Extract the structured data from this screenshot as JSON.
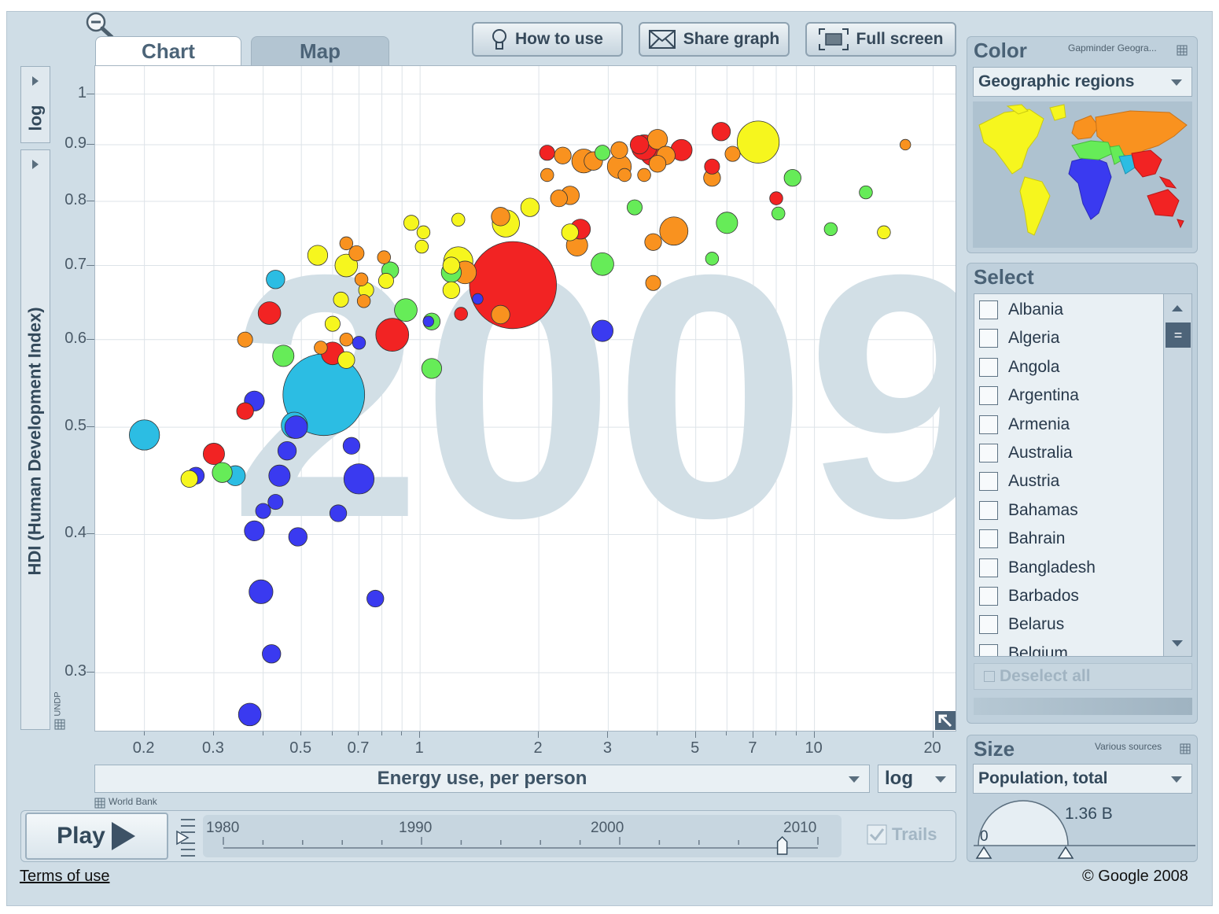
{
  "tabs": {
    "chart": "Chart",
    "map": "Map"
  },
  "toolbar": {
    "how_to_use": "How to use",
    "share_graph": "Share graph",
    "full_screen": "Full screen"
  },
  "y_axis": {
    "scale": "log",
    "label": "HDI (Human Development Index)",
    "source": "UNDP"
  },
  "x_axis": {
    "label": "Energy use, per person",
    "scale": "log",
    "source": "World Bank"
  },
  "year_watermark": "2009",
  "color_panel": {
    "title": "Color",
    "source": "Gapminder Geogra...",
    "selected": "Geographic regions"
  },
  "select_panel": {
    "title": "Select",
    "countries": [
      "Albania",
      "Algeria",
      "Angola",
      "Argentina",
      "Armenia",
      "Australia",
      "Austria",
      "Bahamas",
      "Bahrain",
      "Bangladesh",
      "Barbados",
      "Belarus",
      "Belgium"
    ],
    "deselect_all": "Deselect all"
  },
  "size_panel": {
    "title": "Size",
    "source": "Various sources",
    "selected": "Population, total",
    "min_label": "0",
    "max_label": "1.36 B"
  },
  "playback": {
    "play": "Play",
    "trails": "Trails",
    "years": [
      "1980",
      "1990",
      "2000",
      "2010"
    ],
    "current_fraction": 0.94
  },
  "footer": {
    "terms": "Terms of use",
    "copyright": "© Google 2008"
  },
  "region_colors": {
    "blue": "#3a3af0",
    "cyan": "#2cbde3",
    "green": "#66ec58",
    "yellow": "#f6f61e",
    "orange": "#f9921f",
    "red": "#f22323"
  },
  "chart_data": {
    "type": "scatter",
    "title": "",
    "xlabel": "Energy use, per person",
    "ylabel": "HDI (Human Development Index)",
    "x_scale": "log",
    "y_scale": "log",
    "xlim": [
      0.15,
      23
    ],
    "ylim": [
      0.265,
      1.06
    ],
    "x_ticks": [
      "0.2",
      "0.3",
      "0.5",
      "0.7",
      "1",
      "2",
      "3",
      "5",
      "7",
      "10",
      "20"
    ],
    "y_ticks": [
      "0.3",
      "0.4",
      "0.5",
      "0.6",
      "0.7",
      "0.8",
      "0.9",
      "1"
    ],
    "grid": true,
    "points": [
      {
        "x": 1.72,
        "y": 0.672,
        "size": 1.33,
        "color": "red"
      },
      {
        "x": 0.57,
        "y": 0.535,
        "size": 1.17,
        "color": "cyan"
      },
      {
        "x": 7.2,
        "y": 0.905,
        "size": 0.31,
        "color": "yellow"
      },
      {
        "x": 4.4,
        "y": 0.752,
        "size": 0.14,
        "color": "orange"
      },
      {
        "x": 0.2,
        "y": 0.492,
        "size": 0.16,
        "color": "cyan"
      },
      {
        "x": 0.7,
        "y": 0.449,
        "size": 0.16,
        "color": "blue"
      },
      {
        "x": 0.85,
        "y": 0.606,
        "size": 0.19,
        "color": "red"
      },
      {
        "x": 1.65,
        "y": 0.764,
        "size": 0.13,
        "color": "yellow"
      },
      {
        "x": 1.25,
        "y": 0.706,
        "size": 0.15,
        "color": "yellow"
      },
      {
        "x": 0.415,
        "y": 0.634,
        "size": 0.09,
        "color": "red"
      },
      {
        "x": 0.6,
        "y": 0.583,
        "size": 0.09,
        "color": "red"
      },
      {
        "x": 2.9,
        "y": 0.702,
        "size": 0.09,
        "color": "green"
      },
      {
        "x": 0.92,
        "y": 0.638,
        "size": 0.09,
        "color": "green"
      },
      {
        "x": 3.2,
        "y": 0.86,
        "size": 0.1,
        "color": "orange"
      },
      {
        "x": 3.9,
        "y": 0.885,
        "size": 0.12,
        "color": "red"
      },
      {
        "x": 3.7,
        "y": 0.895,
        "size": 0.11,
        "color": "red"
      },
      {
        "x": 4.6,
        "y": 0.89,
        "size": 0.08,
        "color": "red"
      },
      {
        "x": 2.6,
        "y": 0.87,
        "size": 0.1,
        "color": "orange"
      },
      {
        "x": 0.395,
        "y": 0.355,
        "size": 0.1,
        "color": "blue"
      },
      {
        "x": 0.37,
        "y": 0.275,
        "size": 0.09,
        "color": "blue"
      },
      {
        "x": 0.485,
        "y": 0.5,
        "size": 0.09,
        "color": "blue"
      },
      {
        "x": 0.44,
        "y": 0.452,
        "size": 0.08,
        "color": "blue"
      },
      {
        "x": 0.3,
        "y": 0.473,
        "size": 0.08,
        "color": "red"
      },
      {
        "x": 0.48,
        "y": 0.502,
        "size": 0.12,
        "color": "cyan"
      },
      {
        "x": 0.34,
        "y": 0.452,
        "size": 0.07,
        "color": "cyan"
      },
      {
        "x": 0.315,
        "y": 0.455,
        "size": 0.07,
        "color": "green"
      },
      {
        "x": 1.07,
        "y": 0.565,
        "size": 0.07,
        "color": "green"
      },
      {
        "x": 2.9,
        "y": 0.611,
        "size": 0.08,
        "color": "blue"
      },
      {
        "x": 0.38,
        "y": 0.403,
        "size": 0.07,
        "color": "blue"
      },
      {
        "x": 0.42,
        "y": 0.312,
        "size": 0.06,
        "color": "blue"
      },
      {
        "x": 0.49,
        "y": 0.398,
        "size": 0.06,
        "color": "blue"
      },
      {
        "x": 0.38,
        "y": 0.528,
        "size": 0.07,
        "color": "blue"
      },
      {
        "x": 0.65,
        "y": 0.7,
        "size": 0.09,
        "color": "yellow"
      },
      {
        "x": 0.55,
        "y": 0.715,
        "size": 0.07,
        "color": "yellow"
      },
      {
        "x": 0.45,
        "y": 0.58,
        "size": 0.08,
        "color": "green"
      },
      {
        "x": 0.43,
        "y": 0.68,
        "size": 0.06,
        "color": "cyan"
      },
      {
        "x": 6,
        "y": 0.765,
        "size": 0.08,
        "color": "green"
      },
      {
        "x": 2.5,
        "y": 0.73,
        "size": 0.08,
        "color": "orange"
      },
      {
        "x": 2.55,
        "y": 0.755,
        "size": 0.07,
        "color": "red"
      },
      {
        "x": 1.3,
        "y": 0.69,
        "size": 0.09,
        "color": "orange"
      },
      {
        "x": 1.2,
        "y": 0.69,
        "size": 0.07,
        "color": "green"
      },
      {
        "x": 1.6,
        "y": 0.632,
        "size": 0.06,
        "color": "orange"
      },
      {
        "x": 1.6,
        "y": 0.775,
        "size": 0.06,
        "color": "orange"
      },
      {
        "x": 1.9,
        "y": 0.79,
        "size": 0.06,
        "color": "yellow"
      },
      {
        "x": 2.75,
        "y": 0.87,
        "size": 0.06,
        "color": "orange"
      },
      {
        "x": 5.8,
        "y": 0.925,
        "size": 0.06,
        "color": "red"
      },
      {
        "x": 0.65,
        "y": 0.575,
        "size": 0.05,
        "color": "yellow"
      },
      {
        "x": 0.46,
        "y": 0.476,
        "size": 0.06,
        "color": "blue"
      },
      {
        "x": 0.67,
        "y": 0.481,
        "size": 0.05,
        "color": "blue"
      },
      {
        "x": 0.62,
        "y": 0.418,
        "size": 0.05,
        "color": "blue"
      },
      {
        "x": 0.77,
        "y": 0.35,
        "size": 0.05,
        "color": "blue"
      },
      {
        "x": 0.43,
        "y": 0.428,
        "size": 0.04,
        "color": "blue"
      },
      {
        "x": 0.4,
        "y": 0.42,
        "size": 0.04,
        "color": "blue"
      },
      {
        "x": 0.36,
        "y": 0.517,
        "size": 0.05,
        "color": "red"
      },
      {
        "x": 0.27,
        "y": 0.452,
        "size": 0.05,
        "color": "blue"
      },
      {
        "x": 0.26,
        "y": 0.449,
        "size": 0.05,
        "color": "yellow"
      },
      {
        "x": 0.36,
        "y": 0.6,
        "size": 0.04,
        "color": "orange"
      },
      {
        "x": 3.9,
        "y": 0.735,
        "size": 0.05,
        "color": "orange"
      },
      {
        "x": 3.2,
        "y": 0.89,
        "size": 0.05,
        "color": "orange"
      },
      {
        "x": 4,
        "y": 0.865,
        "size": 0.05,
        "color": "orange"
      },
      {
        "x": 2.25,
        "y": 0.805,
        "size": 0.05,
        "color": "orange"
      },
      {
        "x": 2.4,
        "y": 0.81,
        "size": 0.06,
        "color": "orange"
      },
      {
        "x": 2.4,
        "y": 0.75,
        "size": 0.05,
        "color": "yellow"
      },
      {
        "x": 3.5,
        "y": 0.79,
        "size": 0.04,
        "color": "green"
      },
      {
        "x": 5.5,
        "y": 0.84,
        "size": 0.05,
        "color": "orange"
      },
      {
        "x": 8.8,
        "y": 0.84,
        "size": 0.05,
        "color": "green"
      },
      {
        "x": 1.07,
        "y": 0.623,
        "size": 0.05,
        "color": "green"
      },
      {
        "x": 1.2,
        "y": 0.665,
        "size": 0.05,
        "color": "yellow"
      },
      {
        "x": 0.84,
        "y": 0.693,
        "size": 0.05,
        "color": "green"
      },
      {
        "x": 0.63,
        "y": 0.652,
        "size": 0.04,
        "color": "yellow"
      },
      {
        "x": 0.69,
        "y": 0.718,
        "size": 0.04,
        "color": "orange"
      },
      {
        "x": 0.72,
        "y": 0.65,
        "size": 0.03,
        "color": "orange"
      },
      {
        "x": 0.65,
        "y": 0.733,
        "size": 0.03,
        "color": "orange"
      },
      {
        "x": 0.56,
        "y": 0.59,
        "size": 0.03,
        "color": "orange"
      },
      {
        "x": 0.6,
        "y": 0.62,
        "size": 0.04,
        "color": "yellow"
      },
      {
        "x": 0.65,
        "y": 0.6,
        "size": 0.03,
        "color": "orange"
      },
      {
        "x": 0.7,
        "y": 0.596,
        "size": 0.03,
        "color": "blue"
      },
      {
        "x": 0.95,
        "y": 0.765,
        "size": 0.04,
        "color": "yellow"
      },
      {
        "x": 1.02,
        "y": 0.75,
        "size": 0.03,
        "color": "yellow"
      },
      {
        "x": 1.01,
        "y": 0.728,
        "size": 0.03,
        "color": "yellow"
      },
      {
        "x": 1.25,
        "y": 0.77,
        "size": 0.03,
        "color": "yellow"
      },
      {
        "x": 2.1,
        "y": 0.885,
        "size": 0.04,
        "color": "red"
      },
      {
        "x": 2.9,
        "y": 0.885,
        "size": 0.04,
        "color": "green"
      },
      {
        "x": 8,
        "y": 0.805,
        "size": 0.03,
        "color": "red"
      },
      {
        "x": 8.1,
        "y": 0.78,
        "size": 0.03,
        "color": "green"
      },
      {
        "x": 13.5,
        "y": 0.815,
        "size": 0.03,
        "color": "green"
      },
      {
        "x": 11,
        "y": 0.755,
        "size": 0.03,
        "color": "green"
      },
      {
        "x": 15,
        "y": 0.75,
        "size": 0.03,
        "color": "yellow"
      },
      {
        "x": 17,
        "y": 0.9,
        "size": 0.02,
        "color": "orange"
      },
      {
        "x": 5.5,
        "y": 0.71,
        "size": 0.03,
        "color": "green"
      },
      {
        "x": 3.9,
        "y": 0.675,
        "size": 0.04,
        "color": "orange"
      },
      {
        "x": 1.27,
        "y": 0.633,
        "size": 0.03,
        "color": "red"
      },
      {
        "x": 1.05,
        "y": 0.623,
        "size": 0.02,
        "color": "blue"
      },
      {
        "x": 1.4,
        "y": 0.653,
        "size": 0.02,
        "color": "blue"
      },
      {
        "x": 3.7,
        "y": 0.845,
        "size": 0.03,
        "color": "orange"
      },
      {
        "x": 3.3,
        "y": 0.845,
        "size": 0.03,
        "color": "orange"
      },
      {
        "x": 2.1,
        "y": 0.845,
        "size": 0.03,
        "color": "orange"
      },
      {
        "x": 5.5,
        "y": 0.86,
        "size": 0.04,
        "color": "red"
      },
      {
        "x": 6.2,
        "y": 0.883,
        "size": 0.04,
        "color": "orange"
      },
      {
        "x": 4.2,
        "y": 0.88,
        "size": 0.06,
        "color": "orange"
      },
      {
        "x": 4,
        "y": 0.91,
        "size": 0.07,
        "color": "orange"
      },
      {
        "x": 3.6,
        "y": 0.9,
        "size": 0.06,
        "color": "red"
      },
      {
        "x": 2.3,
        "y": 0.88,
        "size": 0.05,
        "color": "orange"
      },
      {
        "x": 1.2,
        "y": 0.7,
        "size": 0.05,
        "color": "yellow"
      },
      {
        "x": 0.73,
        "y": 0.665,
        "size": 0.04,
        "color": "yellow"
      },
      {
        "x": 0.82,
        "y": 0.678,
        "size": 0.04,
        "color": "yellow"
      },
      {
        "x": 0.81,
        "y": 0.712,
        "size": 0.03,
        "color": "orange"
      },
      {
        "x": 0.71,
        "y": 0.68,
        "size": 0.03,
        "color": "orange"
      }
    ]
  }
}
